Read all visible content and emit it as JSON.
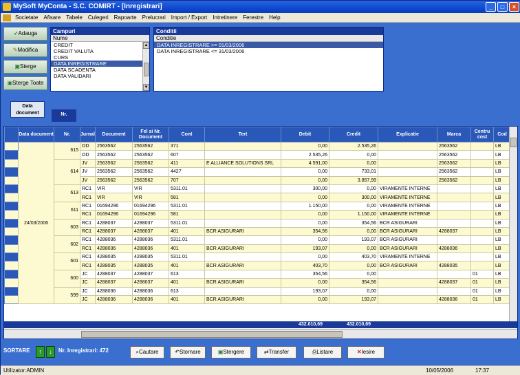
{
  "window": {
    "title": "MySoft MyConta - S.C. COMIRT - [Inregistrari]"
  },
  "menu": [
    "Societate",
    "Afisare",
    "Tabele",
    "Culegeri",
    "Rapoarte",
    "Prelucrari",
    "Import / Export",
    "Intretinere",
    "Ferestre",
    "Help"
  ],
  "buttons": {
    "adauga": "Adauga",
    "modifica": "Modifica",
    "sterge": "Sterge",
    "sterge_toate": "Sterge Toate"
  },
  "campuri": {
    "title": "Campuri",
    "header": "Nume",
    "items": [
      "CREDIT",
      "CREDIT VALUTA",
      "CURS",
      "DATA INREGISTRARE",
      "DATA SCADENTA",
      "DATA VALIDARI"
    ],
    "selected": 3
  },
  "conditii": {
    "title": "Conditii",
    "header": "Conditie",
    "items": [
      "DATA INREGISTRARE >= 01/03/2006",
      "DATA INREGISTRARE <= 31/03/2006"
    ],
    "selected": 0
  },
  "group_tabs": {
    "date": "Data document",
    "nr": "Nr."
  },
  "columns": [
    "Data document",
    "Nr.",
    "Jurnal",
    "Document",
    "Fel si Nr. Document",
    "Cont",
    "Tert",
    "Debit",
    "Credit",
    "Explicatie",
    "Marca",
    "Centru cost",
    "Cod"
  ],
  "rows": [
    {
      "jr": "OD",
      "doc": "2563562",
      "fel": "2563562",
      "cont": "371",
      "tert": "",
      "debit": "0,00",
      "credit": "2.535,26",
      "expl": "",
      "marca": "2563562",
      "cc": "",
      "cod": "LB"
    },
    {
      "jr": "OD",
      "doc": "2563562",
      "fel": "2563562",
      "cont": "607",
      "tert": "",
      "debit": "2.535,26",
      "credit": "0,00",
      "expl": "",
      "marca": "2563562",
      "cc": "",
      "cod": "LB"
    },
    {
      "jr": "JV",
      "doc": "2563562",
      "fel": "2563562",
      "cont": "411",
      "tert": "E ALLIANCE SOLUTIONS SRL",
      "debit": "4.591,00",
      "credit": "0,00",
      "expl": "",
      "marca": "2563562",
      "cc": "",
      "cod": "LB"
    },
    {
      "jr": "JV",
      "doc": "2563562",
      "fel": "2563562",
      "cont": "4427",
      "tert": "",
      "debit": "0,00",
      "credit": "733,01",
      "expl": "",
      "marca": "2563562",
      "cc": "",
      "cod": "LB"
    },
    {
      "jr": "JV",
      "doc": "2563562",
      "fel": "2563562",
      "cont": "707",
      "tert": "",
      "debit": "0,00",
      "credit": "3.857,99",
      "expl": "",
      "marca": "2563562",
      "cc": "",
      "cod": "LB"
    },
    {
      "jr": "RC1",
      "doc": "VIR",
      "fel": "VIR",
      "cont": "5311.01",
      "tert": "",
      "debit": "300,00",
      "credit": "0,00",
      "expl": "VIRAMENTE INTERNE",
      "marca": "",
      "cc": "",
      "cod": "LB"
    },
    {
      "jr": "RC1",
      "doc": "VIR",
      "fel": "VIR",
      "cont": "581",
      "tert": "",
      "debit": "0,00",
      "credit": "300,00",
      "expl": "VIRAMENTE INTERNE",
      "marca": "",
      "cc": "",
      "cod": "LB"
    },
    {
      "jr": "RC1",
      "doc": "01694296",
      "fel": "01694296",
      "cont": "5311.01",
      "tert": "",
      "debit": "1.150,00",
      "credit": "0,00",
      "expl": "VIRAMENTE INTERNE",
      "marca": "",
      "cc": "",
      "cod": "LB"
    },
    {
      "jr": "RC1",
      "doc": "01694296",
      "fel": "01694296",
      "cont": "581",
      "tert": "",
      "debit": "0,00",
      "credit": "1.150,00",
      "expl": "VIRAMENTE INTERNE",
      "marca": "",
      "cc": "",
      "cod": "LB"
    },
    {
      "jr": "RC1",
      "doc": "4288037",
      "fel": "4288037",
      "cont": "5311.01",
      "tert": "",
      "debit": "0,00",
      "credit": "354,56",
      "expl": "BCR ASIGURARI",
      "marca": "",
      "cc": "",
      "cod": "LB"
    },
    {
      "jr": "RC1",
      "doc": "4288037",
      "fel": "4288037",
      "cont": "401",
      "tert": "BCR ASIGURARI",
      "debit": "354,56",
      "credit": "0,00",
      "expl": "BCR ASIGURARI",
      "marca": "4288037",
      "cc": "",
      "cod": "LB"
    },
    {
      "jr": "RC1",
      "doc": "4288036",
      "fel": "4288036",
      "cont": "5311.01",
      "tert": "",
      "debit": "0,00",
      "credit": "193,07",
      "expl": "BCR ASIGURARI",
      "marca": "",
      "cc": "",
      "cod": "LB"
    },
    {
      "jr": "RC1",
      "doc": "4288036",
      "fel": "4288036",
      "cont": "401",
      "tert": "BCR ASIGURARI",
      "debit": "193,07",
      "credit": "0,00",
      "expl": "BCR ASIGURARI",
      "marca": "4288036",
      "cc": "",
      "cod": "LB"
    },
    {
      "jr": "RC1",
      "doc": "4288035",
      "fel": "4288035",
      "cont": "5311.01",
      "tert": "",
      "debit": "0,00",
      "credit": "403,70",
      "expl": "VIRAMENTE INTERNE",
      "marca": "",
      "cc": "",
      "cod": "LB"
    },
    {
      "jr": "RC1",
      "doc": "4288035",
      "fel": "4288035",
      "cont": "401",
      "tert": "BCR ASIGURARI",
      "debit": "403,70",
      "credit": "0,00",
      "expl": "BCR ASIGURARI",
      "marca": "4288035",
      "cc": "",
      "cod": "LB"
    },
    {
      "jr": "JC",
      "doc": "4288037",
      "fel": "4288037",
      "cont": "613",
      "tert": "",
      "debit": "354,56",
      "credit": "0,00",
      "expl": "",
      "marca": "",
      "cc": "01",
      "cod": "LB"
    },
    {
      "jr": "JC",
      "doc": "4288037",
      "fel": "4288037",
      "cont": "401",
      "tert": "BCR ASIGURARI",
      "debit": "0,00",
      "credit": "354,56",
      "expl": "",
      "marca": "4288037",
      "cc": "01",
      "cod": "LB"
    },
    {
      "jr": "JC",
      "doc": "4288036",
      "fel": "4288036",
      "cont": "613",
      "tert": "",
      "debit": "193,07",
      "credit": "0,00",
      "expl": "",
      "marca": "",
      "cc": "01",
      "cod": "LB"
    },
    {
      "jr": "JC",
      "doc": "4288036",
      "fel": "4288036",
      "cont": "401",
      "tert": "BCR ASIGURARI",
      "debit": "0,00",
      "credit": "193,07",
      "expl": "",
      "marca": "4288036",
      "cc": "01",
      "cod": "LB"
    }
  ],
  "group_date": "24/03/2006",
  "group_nrs": [
    {
      "nr": "615",
      "start": 0,
      "span": 2
    },
    {
      "nr": "614",
      "start": 2,
      "span": 3
    },
    {
      "nr": "613",
      "start": 5,
      "span": 2
    },
    {
      "nr": "611",
      "start": 7,
      "span": 2
    },
    {
      "nr": "603",
      "start": 9,
      "span": 2
    },
    {
      "nr": "602",
      "start": 11,
      "span": 2
    },
    {
      "nr": "601",
      "start": 13,
      "span": 2
    },
    {
      "nr": "600",
      "start": 15,
      "span": 2
    },
    {
      "nr": "599",
      "start": 17,
      "span": 2
    }
  ],
  "totals": {
    "debit": "432.010,69",
    "credit": "432.010,69"
  },
  "bottom": {
    "sortare": "SORTARE",
    "nr_label": "Nr. Inregistrari: 472",
    "cautare": "Cautare",
    "stornare": "Stornare",
    "stergere": "Stergere",
    "transfer": "Transfer",
    "listare": "Listare",
    "iesire": "Iesire"
  },
  "status": {
    "user": "Utilizator:ADMIN",
    "date": "10/05/2006",
    "time": "17:37"
  }
}
